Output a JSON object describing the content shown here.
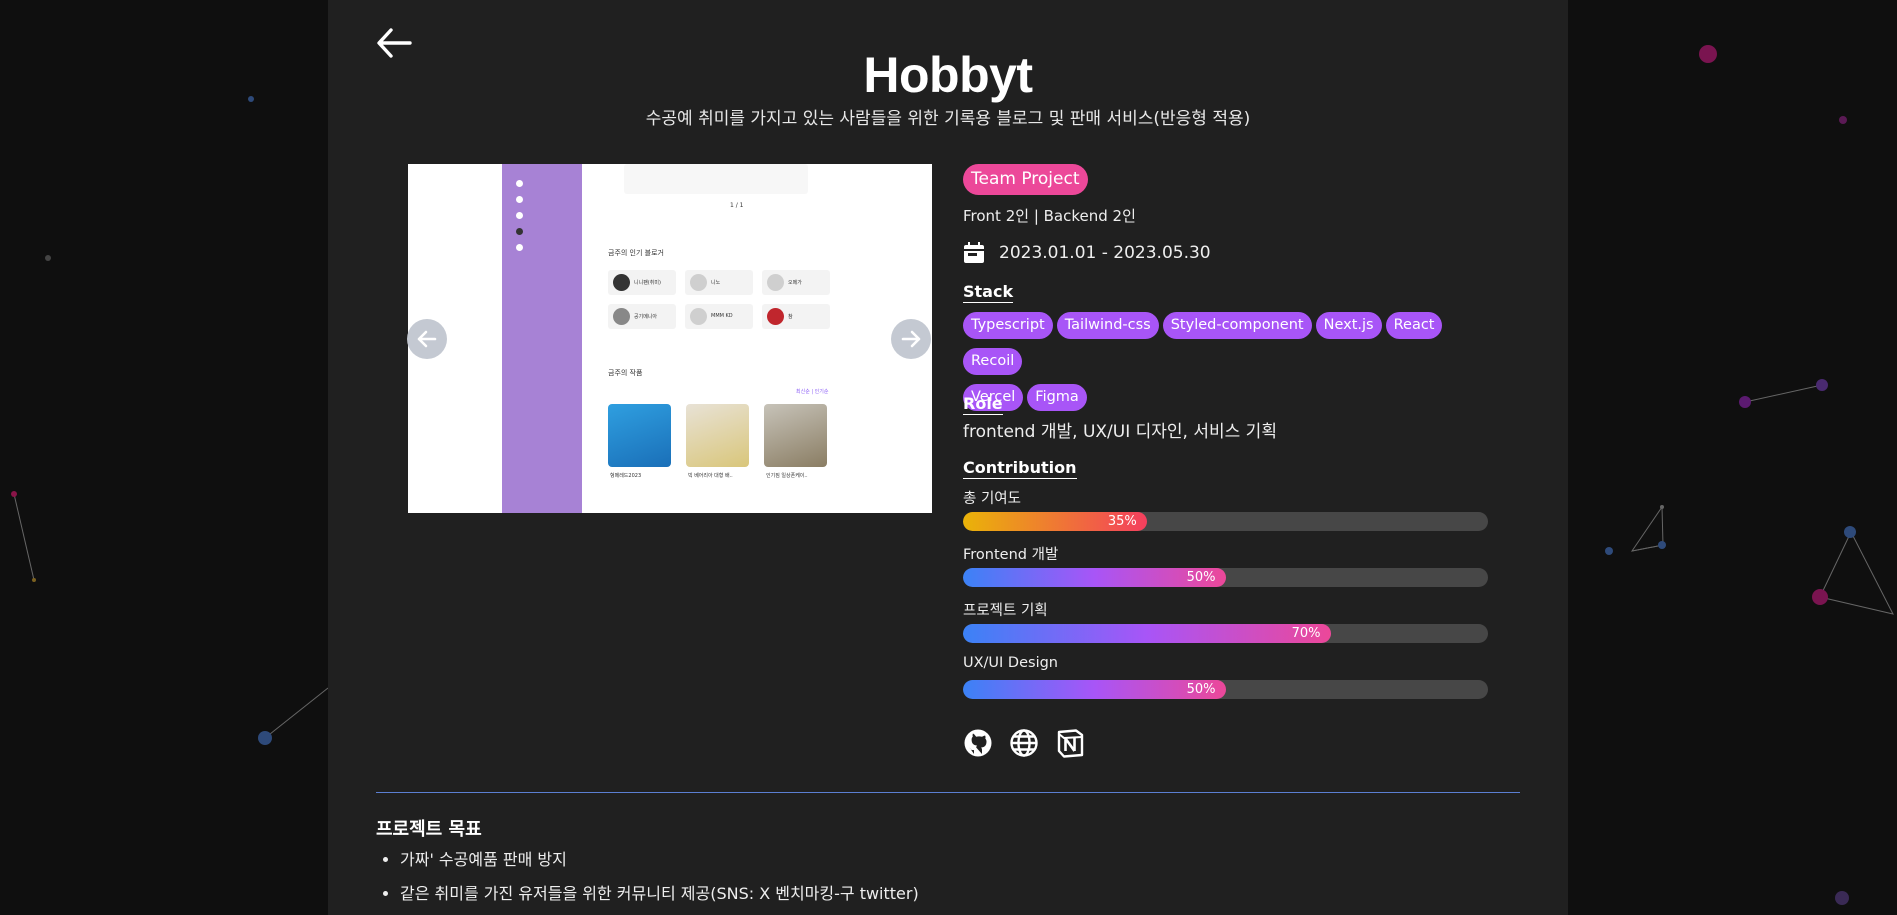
{
  "project": {
    "title": "Hobbyt",
    "subtitle": "수공예 취미를 가지고 있는 사람들을 위한 기록용 블로그 및 판매 서비스(반응형 적용)",
    "badge": "Team Project",
    "team": "Front 2인 | Backend 2인",
    "period": "2023.01.01 - 2023.05.30",
    "stack_label": "Stack",
    "stack": [
      "Typescript",
      "Tailwind-css",
      "Styled-component",
      "Next.js",
      "React",
      "Recoil",
      "Vercel",
      "Figma"
    ],
    "role_label": "Role",
    "role": "frontend 개발, UX/UI 디자인, 서비스 기획",
    "contribution_label": "Contribution",
    "contributions": [
      {
        "label": "총 기여도",
        "value": 35,
        "pct": "35%",
        "gradient": "linear-gradient(90deg,#eab308,#f43f5e)"
      },
      {
        "label": "Frontend 개발",
        "value": 50,
        "pct": "50%",
        "gradient": "linear-gradient(90deg,#3b82f6,#a855f7,#ec4899)"
      },
      {
        "label": "프로젝트 기획",
        "value": 70,
        "pct": "70%",
        "gradient": "linear-gradient(90deg,#3b82f6,#a855f7,#ec4899)"
      },
      {
        "label": "UX/UI Design",
        "value": 50,
        "pct": "50%",
        "gradient": "linear-gradient(90deg,#3b82f6,#a855f7,#ec4899)"
      }
    ],
    "links": [
      "github-icon",
      "globe-icon",
      "notion-icon"
    ],
    "goals_title": "프로젝트 목표",
    "goals": [
      "가짜' 수공예품 판매 방지",
      "같은 취미를 가진 유저들을 위한 커뮤니티 제공(SNS: X 벤치마킹-구 twitter)"
    ]
  },
  "screenshot": {
    "pagination": "1 / 1",
    "popular_title": "금주의 인기 블로거",
    "bloggers": [
      "니니팬(취미)",
      "니노",
      "오메가",
      "공기메니아",
      "MMM KD",
      "참"
    ],
    "works_title": "금주의 작품",
    "more": "최신순 | 인기순",
    "works": [
      "헝메레드2023",
      "빅 베어리아 대형 배..",
      "인기짐 일상폰케이.."
    ]
  },
  "colors": {
    "accent_pink": "#ec4899",
    "tag_purple": "#a855f7",
    "divider": "#5b7fd2"
  }
}
